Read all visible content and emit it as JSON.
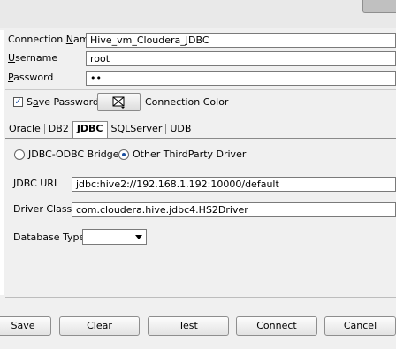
{
  "form": {
    "connection_name_label": "Connection Name",
    "connection_name_value": "Hive_vm_Cloudera_JDBC",
    "username_label": "Username",
    "username_value": "root",
    "password_label": "Password",
    "password_value": "••",
    "save_password_label": "Save Password",
    "save_password_checked": true,
    "connection_color_label": "Connection Color"
  },
  "tabs": [
    {
      "label": "Oracle"
    },
    {
      "label": "DB2"
    },
    {
      "label": "JDBC",
      "active": true
    },
    {
      "label": "SQLServer"
    },
    {
      "label": "UDB"
    }
  ],
  "jdbc": {
    "radio_bridge_label": "JDBC-ODBC Bridge",
    "radio_other_label": "Other ThirdParty Driver",
    "selected_radio": "Other ThirdParty Driver",
    "url_label": "JDBC URL",
    "url_value": "jdbc:hive2://192.168.1.192:10000/default",
    "driver_class_label": "Driver Class",
    "driver_class_value": "com.cloudera.hive.jdbc4.HS2Driver",
    "database_type_label": "Database Type",
    "database_type_value": ""
  },
  "buttons": {
    "save": "Save",
    "clear": "Clear",
    "test": "Test",
    "connect": "Connect",
    "cancel": "Cancel"
  },
  "icons": {
    "color_picker": "color-swatch-icon",
    "dropdown": "chevron-down-icon"
  }
}
